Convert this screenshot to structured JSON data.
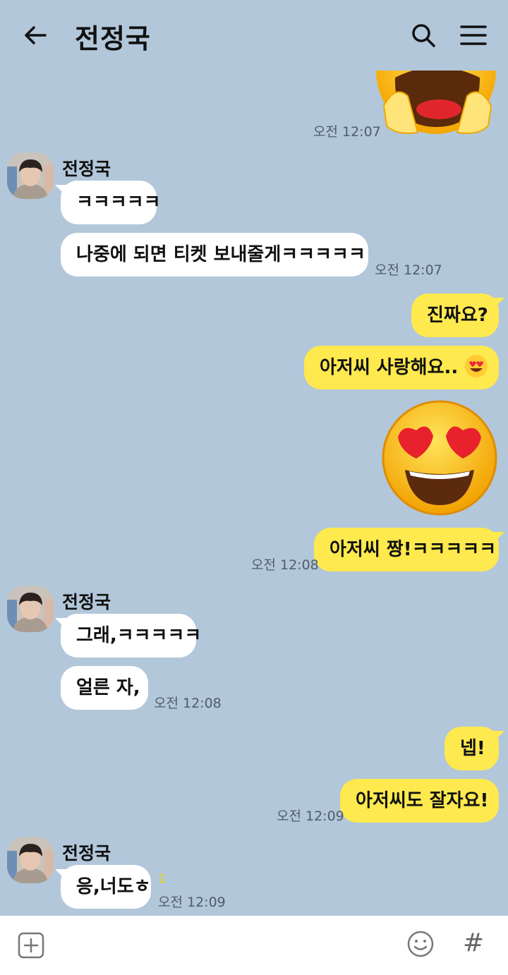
{
  "header": {
    "title": "전정국"
  },
  "messages": {
    "t1": "오전 12:07",
    "sender1": "전정국",
    "m1": "ㅋㅋㅋㅋㅋ",
    "m2": "나중에 되면 티켓 보내줄게ㅋㅋㅋㅋㅋ",
    "t2": "오전 12:07",
    "m3": "진짜요?",
    "m4": "아저씨 사랑해요..",
    "m5": "아저씨 짱!ㅋㅋㅋㅋㅋ",
    "t3": "오전 12:08",
    "sender2": "전정국",
    "m6": "그래,ㅋㅋㅋㅋㅋ",
    "m7": "얼른 자,",
    "t4": "오전 12:08",
    "m8": "넵!",
    "m9": "아저씨도 잘자요!",
    "t5": "오전 12:09",
    "sender3": "전정국",
    "m10": "응,너도ㅎ",
    "unread": "1",
    "t6": "오전 12:09"
  },
  "input_bar": {
    "hash_label": "#"
  },
  "icons": [
    "back-arrow-icon",
    "search-icon",
    "menu-icon",
    "plus-icon",
    "emoji-icon",
    "laughing-emoji-sticker",
    "heart-eyes-emoji-sticker",
    "heart-eyes-emoji-icon"
  ],
  "colors": {
    "background": "#b2c7da",
    "outgoing_bubble": "#fee94e",
    "incoming_bubble": "#ffffff",
    "unread": "#f5d400"
  }
}
